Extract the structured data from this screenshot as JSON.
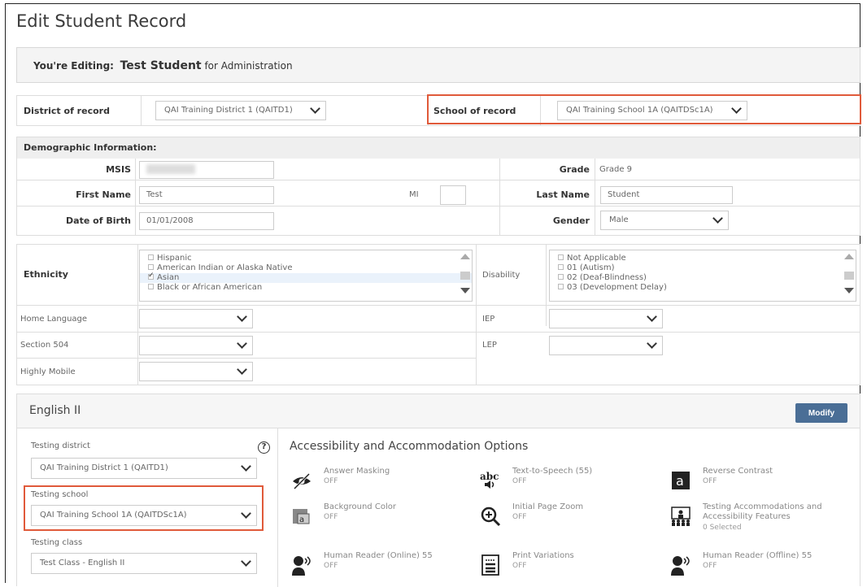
{
  "page": {
    "title": "Edit Student Record"
  },
  "editing": {
    "prefix": "You're Editing:",
    "student": "Test Student",
    "suffix": "for Administration"
  },
  "record": {
    "district_label": "District of record",
    "district_value": "QAI Training District 1 (QAITD1)",
    "school_label": "School of record",
    "school_value": "QAI Training School 1A (QAITDSc1A)"
  },
  "demographics": {
    "heading": "Demographic Information:",
    "msis_label": "MSIS",
    "grade_label": "Grade",
    "grade_value": "Grade 9",
    "first_name_label": "First Name",
    "first_name_value": "Test",
    "mi_label": "MI",
    "last_name_label": "Last Name",
    "last_name_value": "Student",
    "dob_label": "Date of Birth",
    "dob_value": "01/01/2008",
    "gender_label": "Gender",
    "gender_value": "Male"
  },
  "ethnicity": {
    "label": "Ethnicity",
    "options": [
      "Hispanic",
      "American Indian or Alaska Native",
      "Asian",
      "Black or African American"
    ],
    "selected": "Asian"
  },
  "disability": {
    "label": "Disability",
    "options": [
      "Not Applicable",
      "01 (Autism)",
      "02 (Deaf-Blindness)",
      "03 (Development Delay)"
    ]
  },
  "fields": {
    "home_language": "Home Language",
    "iep": "IEP",
    "section_504": "Section 504",
    "lep": "LEP",
    "highly_mobile": "Highly Mobile"
  },
  "course": {
    "title": "English II",
    "modify_label": "Modify",
    "testing_district_label": "Testing district",
    "testing_district_value": "QAI Training District 1 (QAITD1)",
    "testing_school_label": "Testing school",
    "testing_school_value": "QAI Training School 1A (QAITDSc1A)",
    "testing_class_label": "Testing class",
    "testing_class_value": "Test Class - English II",
    "help_glyph": "?"
  },
  "accommodations": {
    "title": "Accessibility and Accommodation Options",
    "items": [
      {
        "name": "Answer Masking",
        "state": "OFF",
        "icon": "answer-masking-icon"
      },
      {
        "name": "Text-to-Speech (55)",
        "state": "OFF",
        "icon": "text-to-speech-icon"
      },
      {
        "name": "Reverse Contrast",
        "state": "OFF",
        "icon": "reverse-contrast-icon"
      },
      {
        "name": "Background Color",
        "state": "OFF",
        "icon": "background-color-icon"
      },
      {
        "name": "Initial Page Zoom",
        "state": "OFF",
        "icon": "zoom-icon"
      },
      {
        "name": "Testing Accommodations and Accessibility Features",
        "state": "0 Selected",
        "icon": "testing-accommodations-icon"
      },
      {
        "name": "Human Reader (Online) 55",
        "state": "OFF",
        "icon": "human-reader-online-icon"
      },
      {
        "name": "Print Variations",
        "state": "OFF",
        "icon": "print-variations-icon"
      },
      {
        "name": "Human Reader (Offline) 55",
        "state": "OFF",
        "icon": "human-reader-offline-icon"
      }
    ],
    "icon_text": {
      "abc": "abc",
      "a": "a"
    }
  },
  "colors": {
    "accent_red": "#e05a3a",
    "button_blue": "#4a6e96"
  }
}
